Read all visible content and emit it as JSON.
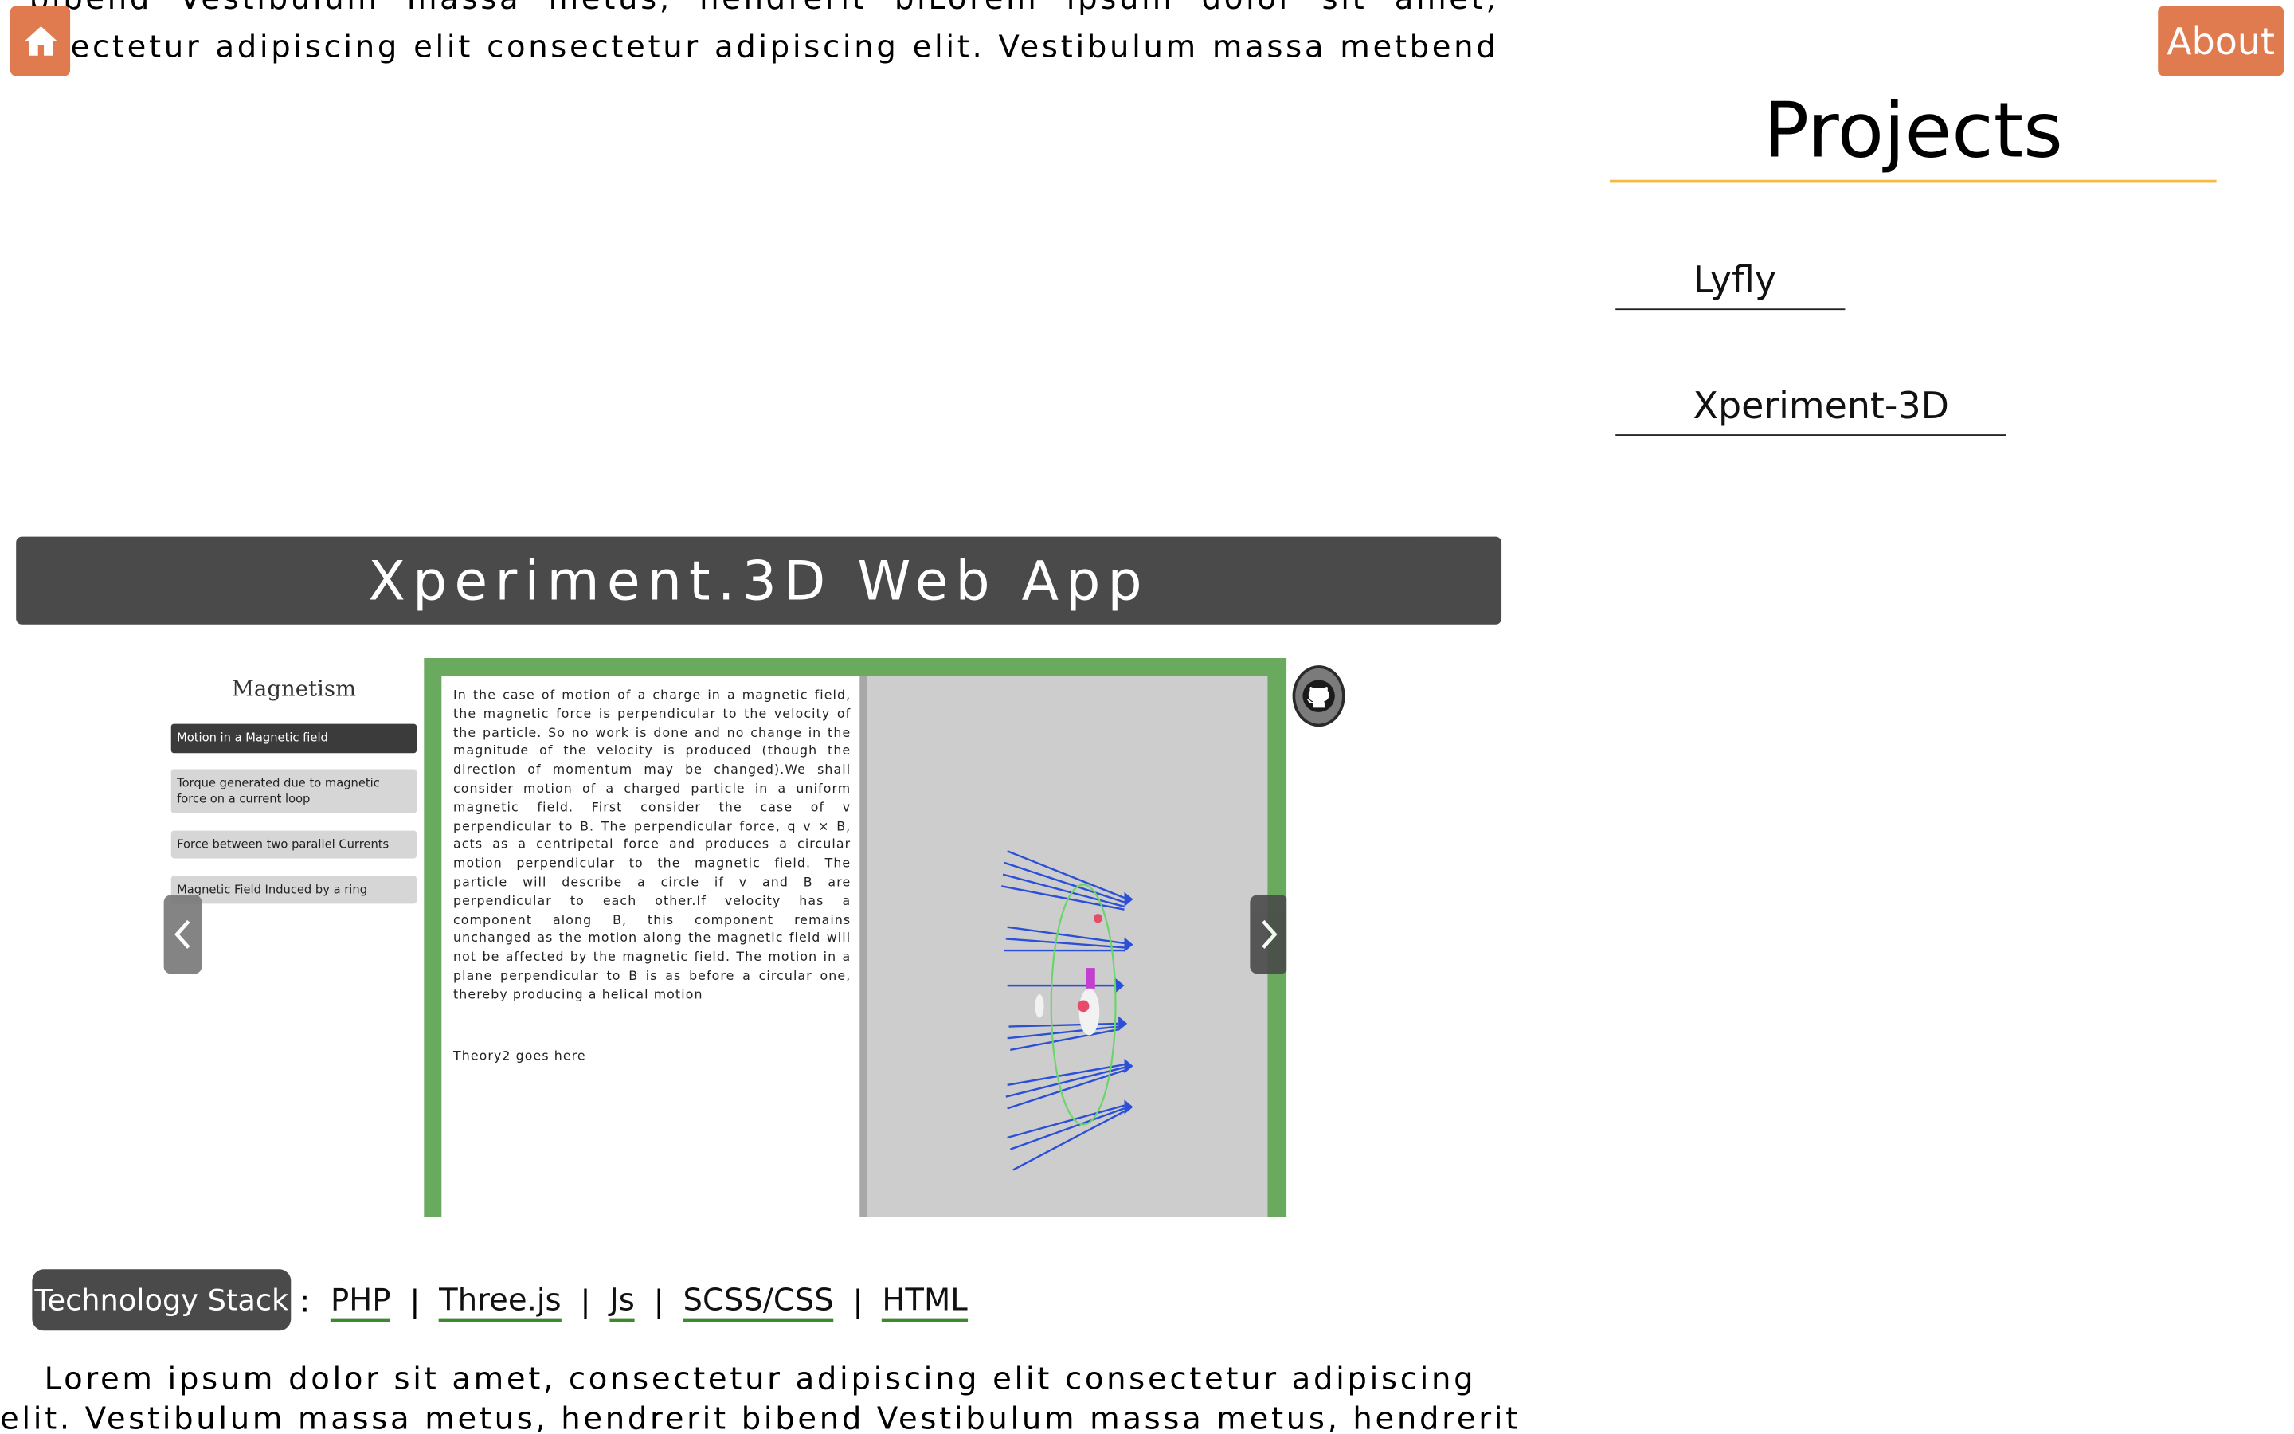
{
  "nav": {
    "home_icon": "home-icon",
    "about_label": "About"
  },
  "intro": {
    "line1": "bibend  Vestibulum  massa  metus,  hendrerit  biLorem  ipsum  dolor  sit  amet,",
    "line2": "nsectetur  adipiscing  elit  consectetur  adipiscing  elit.  Vestibulum  massa  metbend"
  },
  "sidebar": {
    "title": "Projects",
    "items": [
      {
        "label": "Lyfly"
      },
      {
        "label": "Xperiment-3D"
      }
    ]
  },
  "project": {
    "title": "Xperiment.3D Web App",
    "screenshot": {
      "panel_title": "Magnetism",
      "topics": [
        "Motion in a Magnetic field",
        "Torque generated due to magnetic force on a current loop",
        "Force between two parallel Currents",
        "Magnetic Field Induced by a ring"
      ],
      "theory": "In the case of motion of a charge in a magnetic field, the magnetic force is perpendicular to the velocity of the particle. So no work is done and no change in the magnitude of the velocity is produced (though the direction of momentum may be changed).We shall consider motion of a charged particle in a uniform magnetic field. First consider the case of v perpendicular to B. The perpendicular force, q v × B, acts as a centripetal force and produces a circular motion perpendicular to the magnetic field. The particle will describe a circle if v and B are perpendicular to each other.If velocity has a component along B, this component remains unchanged as the motion along the magnetic field will not be affected by the magnetic field. The motion in a plane perpendicular to B is as before a circular one, thereby producing a helical motion",
      "theory2": "Theory2 goes here"
    },
    "carousel_prev_icon": "chevron-left-icon",
    "carousel_next_icon": "chevron-right-icon",
    "github_icon": "github-icon",
    "tech_label": "Technology Stack",
    "tech_colon": ":",
    "tech_sep": "|",
    "tech": [
      "PHP",
      "Three.js",
      "Js",
      "SCSS/CSS",
      "HTML"
    ]
  },
  "description": {
    "line1": "Lorem  ipsum  dolor  sit  amet,  consectetur  adipiscing  elit  consectetur  adipiscing",
    "line2": "elit.  Vestibulum  massa  metus,  hendrerit  bibend  Vestibulum  massa  metus,  hendrerit"
  },
  "colors": {
    "accent": "#e07b4f",
    "rule": "#f4b942",
    "header_bg": "#4a4a4a",
    "link_underline": "#3d8a2e",
    "frame_green": "#6aaa5f"
  }
}
